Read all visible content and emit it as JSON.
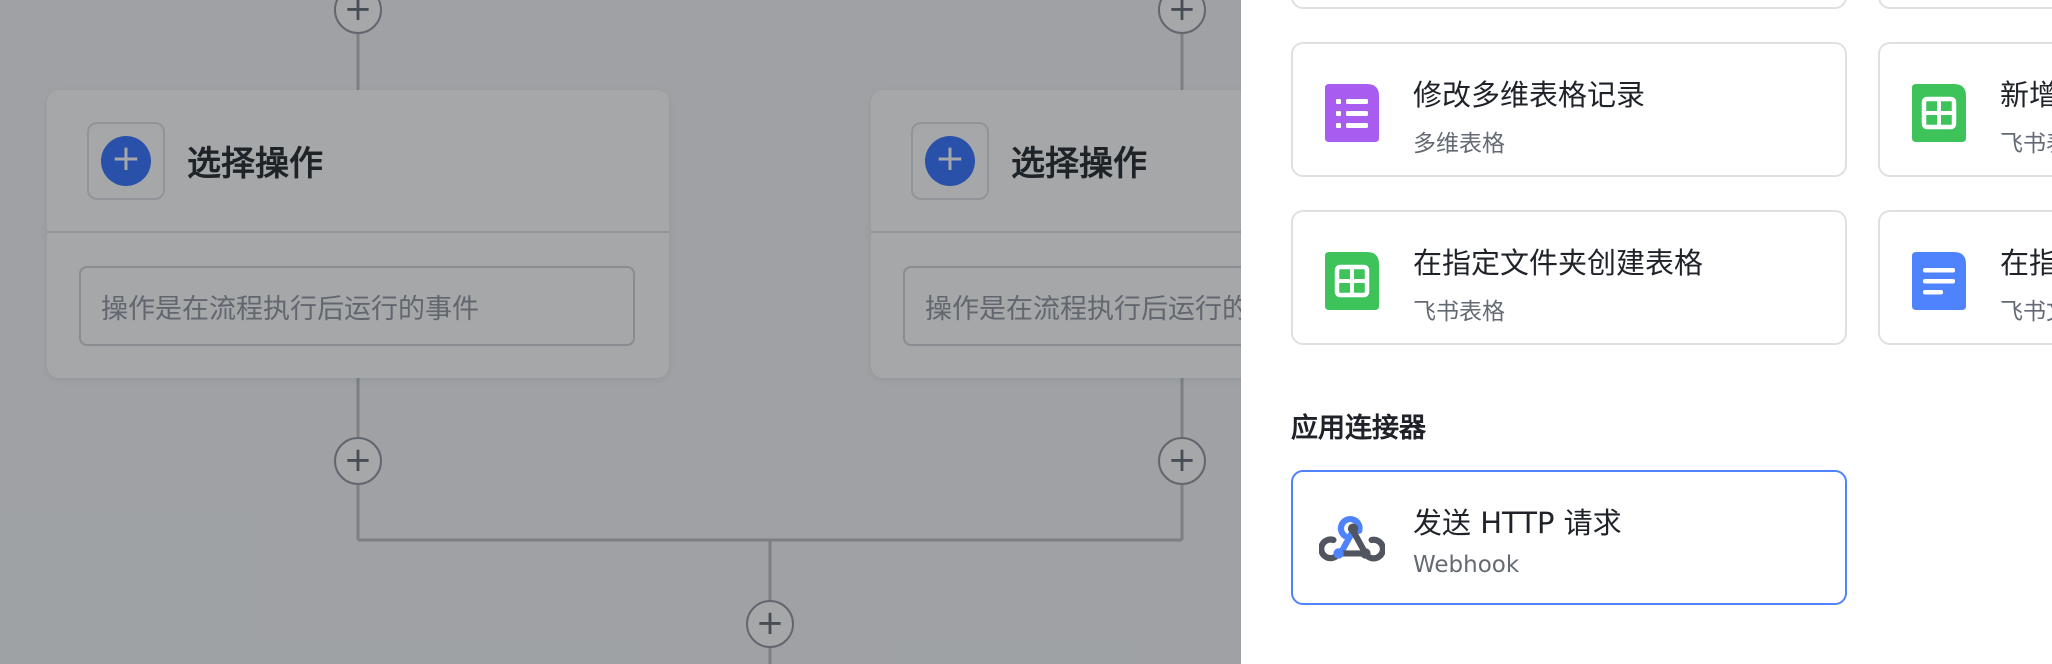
{
  "workflow": {
    "branches": [
      {
        "card_title": "选择操作",
        "input_placeholder": "操作是在流程执行后运行的事件"
      },
      {
        "card_title": "选择操作",
        "input_placeholder": "操作是在流程执行后运行的事件"
      }
    ],
    "add_node_symbol": "+"
  },
  "drawer": {
    "top_cards": [
      {
        "title": "修改多维表格记录",
        "subtitle": "多维表格",
        "icon": "bitable-icon",
        "color": "#a85cf0"
      },
      {
        "title": "新增",
        "subtitle": "飞书表",
        "icon": "sheet-icon",
        "color": "#3ec35a"
      },
      {
        "title": "在指定文件夹创建表格",
        "subtitle": "飞书表格",
        "icon": "sheet-icon",
        "color": "#3ec35a"
      },
      {
        "title": "在指",
        "subtitle": "飞书文",
        "icon": "doc-icon",
        "color": "#4e83fd"
      }
    ],
    "connector_section": {
      "title": "应用连接器",
      "cards": [
        {
          "title": "发送 HTTP 请求",
          "subtitle": "Webhook",
          "icon": "webhook-icon",
          "color": "#4e83fd"
        }
      ]
    }
  },
  "colors": {
    "primary": "#3370ff",
    "border": "#dee0e3",
    "text": "#1f2329",
    "subtext": "#646a73",
    "mask": "rgba(31,35,41,0.40)"
  }
}
